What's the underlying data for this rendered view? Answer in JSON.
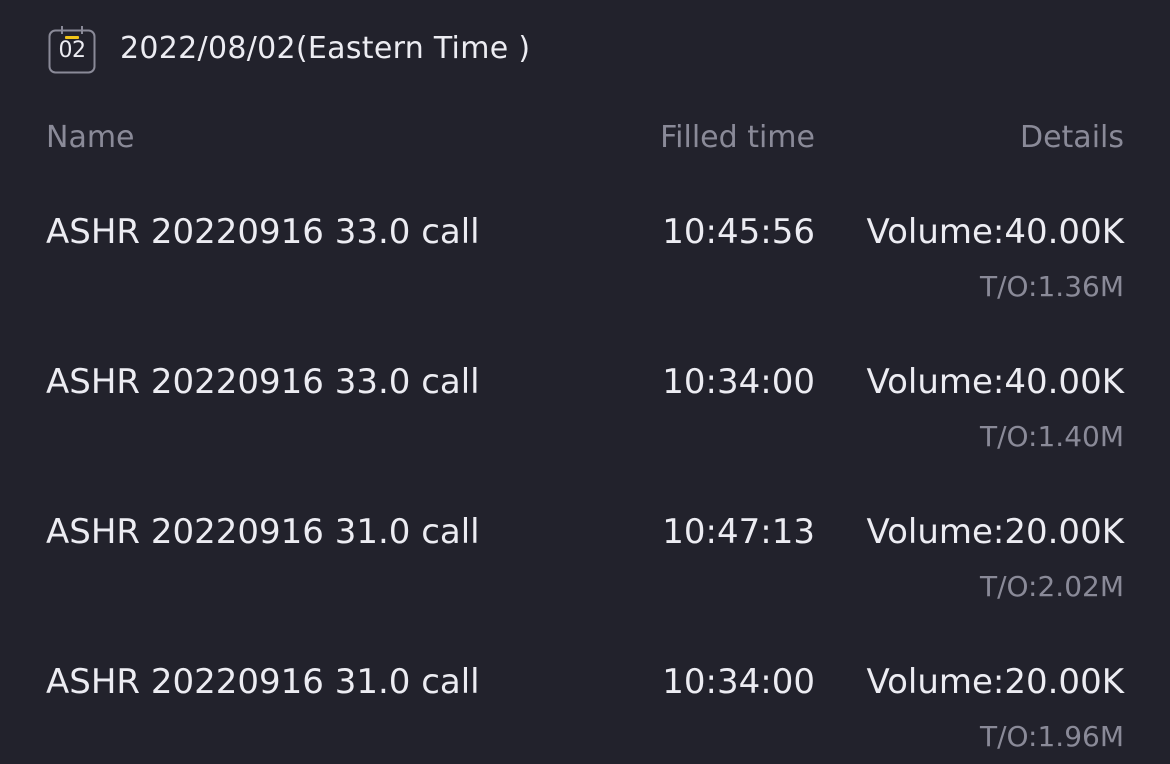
{
  "header": {
    "calendar_day": "02",
    "date_label": "2022/08/02(Eastern Time )",
    "icon": "calendar-icon",
    "accent_color": "#f0c419"
  },
  "columns": {
    "name": "Name",
    "filled_time": "Filled time",
    "details": "Details"
  },
  "rows": [
    {
      "name": "ASHR 20220916 33.0 call",
      "time": "10:45:56",
      "volume": "Volume:40.00K",
      "turnover": "T/O:1.36M"
    },
    {
      "name": "ASHR 20220916 33.0 call",
      "time": "10:34:00",
      "volume": "Volume:40.00K",
      "turnover": "T/O:1.40M"
    },
    {
      "name": "ASHR 20220916 31.0 call",
      "time": "10:47:13",
      "volume": "Volume:20.00K",
      "turnover": "T/O:2.02M"
    },
    {
      "name": "ASHR 20220916 31.0 call",
      "time": "10:34:00",
      "volume": "Volume:20.00K",
      "turnover": "T/O:1.96M"
    }
  ]
}
